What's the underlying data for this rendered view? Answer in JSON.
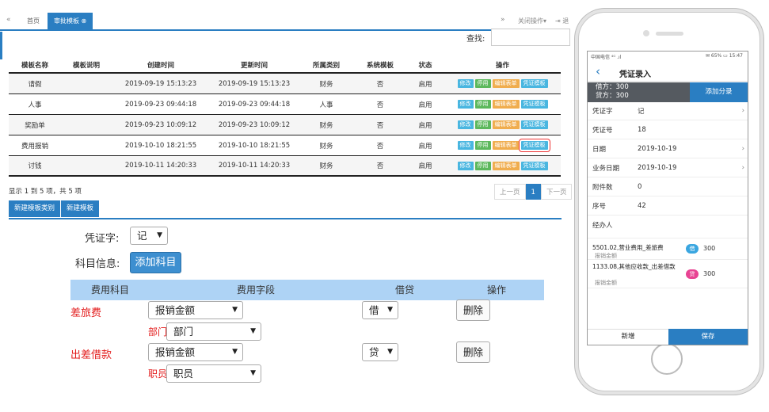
{
  "tabbar": {
    "back_icon": "«",
    "forward_icon": "»",
    "tabs": [
      {
        "label": "首页"
      },
      {
        "label": "审批模板"
      }
    ],
    "close_ops_label": "关闭操作▾",
    "exit_label": "⇥ 退"
  },
  "search": {
    "label": "查找:",
    "placeholder": ""
  },
  "grid": {
    "headers": [
      "模板名称",
      "模板说明",
      "创建时间",
      "更新时间",
      "所属类别",
      "系统模板",
      "状态",
      "操作"
    ],
    "rows": [
      {
        "name": "请假",
        "desc": "",
        "created": "2019-09-19 15:13:23",
        "updated": "2019-09-19 15:13:23",
        "category": "财务",
        "system": "否",
        "status": "启用"
      },
      {
        "name": "人事",
        "desc": "",
        "created": "2019-09-23 09:44:18",
        "updated": "2019-09-23 09:44:18",
        "category": "人事",
        "system": "否",
        "status": "启用"
      },
      {
        "name": "奖励单",
        "desc": "",
        "created": "2019-09-23 10:09:12",
        "updated": "2019-09-23 10:09:12",
        "category": "财务",
        "system": "否",
        "status": "启用"
      },
      {
        "name": "费用报销",
        "desc": "",
        "created": "2019-10-10 18:21:55",
        "updated": "2019-10-10 18:21:55",
        "category": "财务",
        "system": "否",
        "status": "启用"
      },
      {
        "name": "讨钱",
        "desc": "",
        "created": "2019-10-11 14:20:33",
        "updated": "2019-10-11 14:20:33",
        "category": "财务",
        "system": "否",
        "status": "启用"
      }
    ],
    "ops": {
      "edit": "修改",
      "stop": "停用",
      "form": "编辑表单",
      "voucher": "凭证模板"
    }
  },
  "pager": {
    "info": "显示 1 到 5 项，共 5 项",
    "prev": "上一页",
    "current": "1",
    "next": "下一页"
  },
  "buttons": {
    "new_category": "新建模板类别",
    "new_template": "新建模板"
  },
  "form": {
    "voucher_word_label": "凭证字:",
    "voucher_word_value": "记",
    "subject_info_label": "科目信息:",
    "add_subject_label": "添加科目",
    "table_headers": [
      "费用科目",
      "费用字段",
      "借贷",
      "操作"
    ],
    "rows": [
      {
        "subject": "差旅费",
        "field": "报销金额",
        "dc": "借",
        "delete": "删除",
        "extra_label": "部门",
        "extra_value": "部门"
      },
      {
        "subject": "出差借款",
        "field": "报销金额",
        "dc": "贷",
        "delete": "删除",
        "extra_label": "职员",
        "extra_value": "职员"
      }
    ]
  },
  "phone": {
    "status_left": "中国电信 ⁴ᴳ .ıl",
    "status_right": "✉ 65% ▭ 15:47",
    "back_icon": "‹",
    "title": "凭证录入",
    "debit": "借方：300",
    "credit": "贷方：300",
    "add_entry": "添加分录",
    "fields": [
      {
        "key": "凭证字",
        "value": "记",
        "chevron": true
      },
      {
        "key": "凭证号",
        "value": "18",
        "chevron": false
      },
      {
        "key": "日期",
        "value": "2019-10-19",
        "chevron": true
      },
      {
        "key": "业务日期",
        "value": "2019-10-19",
        "chevron": true
      },
      {
        "key": "附件数",
        "value": "0",
        "chevron": false
      },
      {
        "key": "序号",
        "value": "42",
        "chevron": false
      },
      {
        "key": "经办人",
        "value": "",
        "chevron": false
      }
    ],
    "entries": [
      {
        "account": "5501.02,营业费用_差旅费",
        "sub": "报销金额",
        "dc": "借",
        "amount": "300",
        "color": "#3aa6e0"
      },
      {
        "account": "1133.08,其他应收款_出差借款",
        "sub": "报销金额",
        "dc": "贷",
        "amount": "300",
        "color": "#e84393"
      }
    ],
    "new_btn": "新增",
    "save_btn": "保存"
  }
}
